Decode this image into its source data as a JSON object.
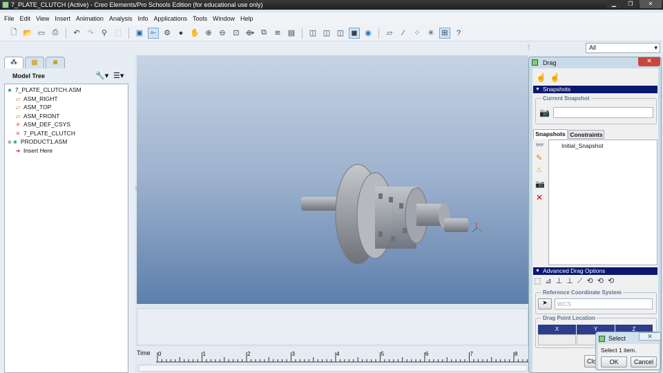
{
  "window": {
    "title": "7_PLATE_CLUTCH (Active) - Creo Elements/Pro Schools Edition (for educational use only)"
  },
  "menu": [
    "File",
    "Edit",
    "View",
    "Insert",
    "Animation",
    "Analysis",
    "Info",
    "Applications",
    "Tools",
    "Window",
    "Help"
  ],
  "filter": {
    "value": "All"
  },
  "model_tree": {
    "title": "Model Tree",
    "items": [
      {
        "label": "7_PLATE_CLUTCH.ASM",
        "icon": "assembly-icon"
      },
      {
        "label": "ASM_RIGHT",
        "icon": "datum-plane-icon"
      },
      {
        "label": "ASM_TOP",
        "icon": "datum-plane-icon"
      },
      {
        "label": "ASM_FRONT",
        "icon": "datum-plane-icon"
      },
      {
        "label": "ASM_DEF_CSYS",
        "icon": "csys-icon"
      },
      {
        "label": "7_PLATE_CLUTCH",
        "icon": "csys-icon"
      },
      {
        "label": "PRODUCT1.ASM",
        "icon": "assembly-icon"
      },
      {
        "label": "Insert Here",
        "icon": "insert-arrow-icon"
      }
    ]
  },
  "timeline": {
    "label": "Time",
    "ticks": [
      "0",
      "1",
      "2",
      "3",
      "4",
      "5",
      "6",
      "7",
      "8"
    ]
  },
  "drag": {
    "title": "Drag",
    "snapshots_section": "Snapshots",
    "current_snapshot_label": "Current Snapshot",
    "current_snapshot_value": "",
    "tabs": [
      "Snapshots",
      "Constraints"
    ],
    "snapshot_list": [
      "Initial_Snapshot"
    ],
    "advanced_section": "Advanced Drag Options",
    "ref_csys_label": "Reference Coordinate System",
    "ref_csys_placeholder": "WCS",
    "drag_point_label": "Drag Point Location",
    "columns": [
      "X",
      "Y",
      "Z"
    ],
    "close_label": "Close"
  },
  "select_dialog": {
    "title": "Select",
    "message": "Select 1 item.",
    "ok": "OK",
    "cancel": "Cancel"
  }
}
